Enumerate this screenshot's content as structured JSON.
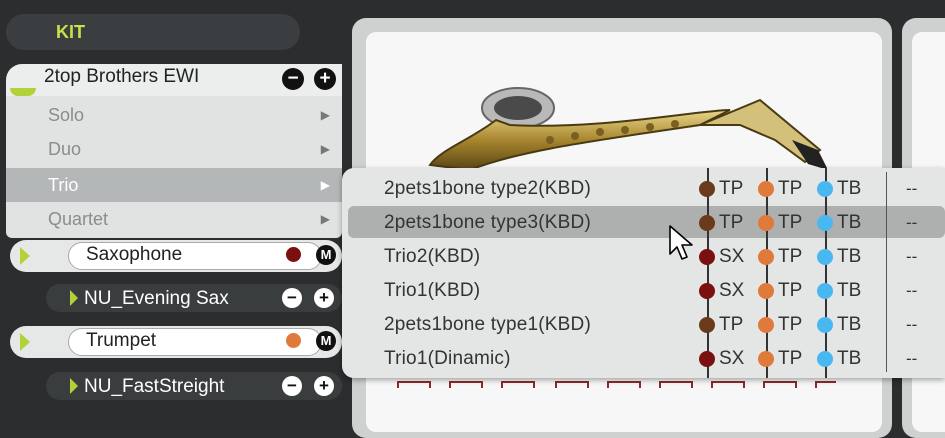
{
  "kit_header": {
    "label": "KIT"
  },
  "kit_row": {
    "name": "2top Brothers EWI",
    "minus": "−",
    "plus": "+"
  },
  "category_menu": {
    "items": [
      {
        "label": "Solo",
        "arrow": "▶"
      },
      {
        "label": "Duo",
        "arrow": "▶"
      },
      {
        "label": "Trio",
        "arrow": "▶",
        "selected": true
      },
      {
        "label": "Quartet",
        "arrow": "▶"
      }
    ]
  },
  "instruments": [
    {
      "name": "Saxophone",
      "dot_color": "#7a1010",
      "m": "M",
      "preset": "NU_Evening Sax",
      "minus": "−",
      "plus": "+"
    },
    {
      "name": "Trumpet",
      "dot_color": "#e07a3a",
      "m": "M",
      "preset": "NU_FastStreight",
      "minus": "−",
      "plus": "+"
    }
  ],
  "dropdown": {
    "highlighted_index": 1,
    "items": [
      {
        "name": "2pets1bone type2(KBD)",
        "tags": [
          "TP",
          "TP",
          "TB"
        ],
        "dot_colors": [
          "#6b3a1a",
          "#e07a3a",
          "#4ab8f0"
        ],
        "dash": "--"
      },
      {
        "name": "2pets1bone type3(KBD)",
        "tags": [
          "TP",
          "TP",
          "TB"
        ],
        "dot_colors": [
          "#6b3a1a",
          "#e07a3a",
          "#4ab8f0"
        ],
        "dash": "--"
      },
      {
        "name": "Trio2(KBD)",
        "tags": [
          "SX",
          "TP",
          "TB"
        ],
        "dot_colors": [
          "#7a1010",
          "#e07a3a",
          "#4ab8f0"
        ],
        "dash": "--"
      },
      {
        "name": "Trio1(KBD)",
        "tags": [
          "SX",
          "TP",
          "TB"
        ],
        "dot_colors": [
          "#7a1010",
          "#e07a3a",
          "#4ab8f0"
        ],
        "dash": "--"
      },
      {
        "name": "2pets1bone type1(KBD)",
        "tags": [
          "TP",
          "TP",
          "TB"
        ],
        "dot_colors": [
          "#6b3a1a",
          "#e07a3a",
          "#4ab8f0"
        ],
        "dash": "--"
      },
      {
        "name": "Trio1(Dinamic)",
        "tags": [
          "SX",
          "TP",
          "TB"
        ],
        "dot_colors": [
          "#7a1010",
          "#e07a3a",
          "#4ab8f0"
        ],
        "dash": "--"
      }
    ]
  },
  "colors": {
    "accent_green": "#b2d23a",
    "kit_label": "#c8e04a",
    "sax_dot": "#7a1010",
    "trumpet_dot": "#e07a3a",
    "trombone_dot": "#4ab8f0"
  }
}
